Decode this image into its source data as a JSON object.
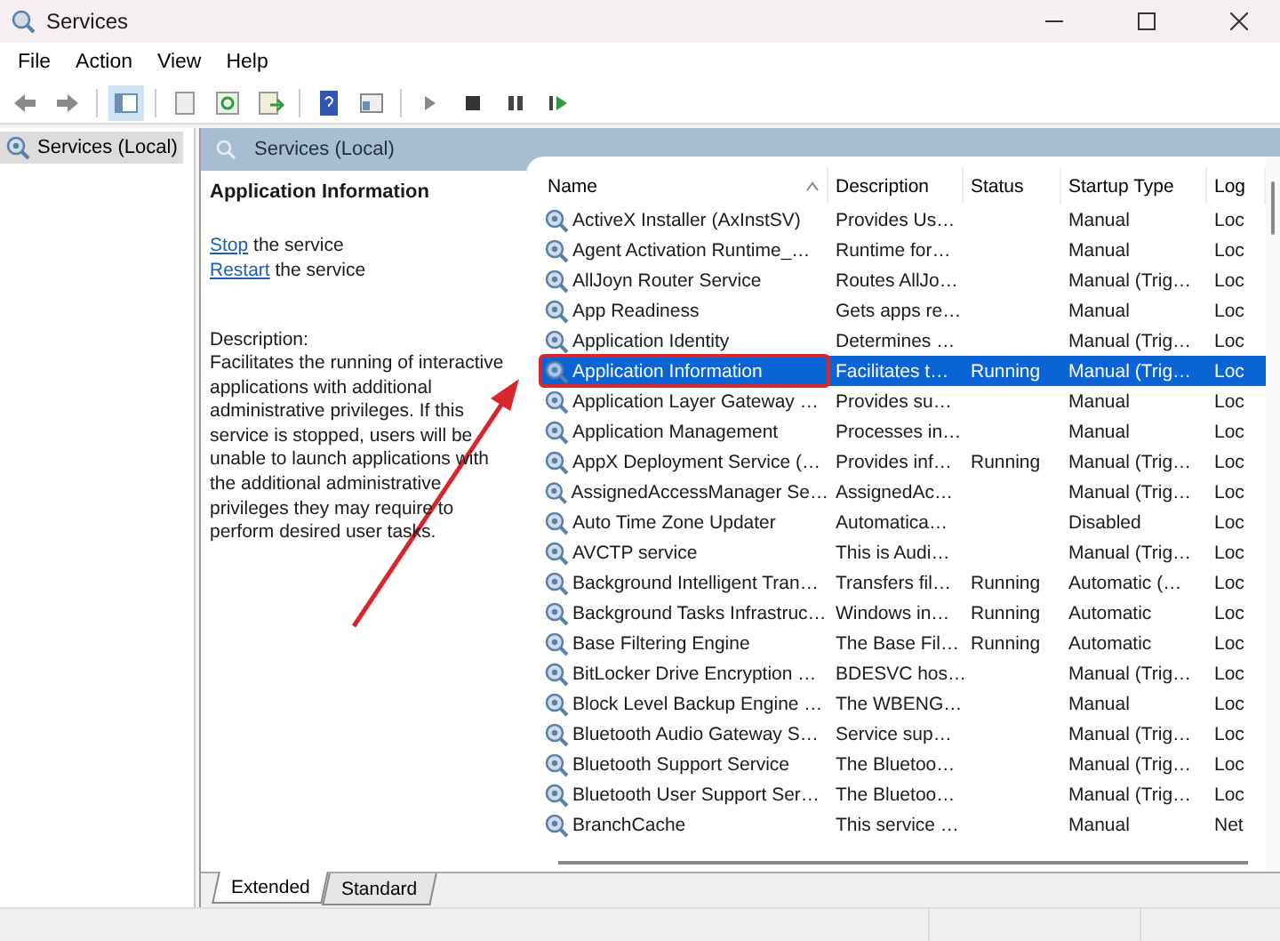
{
  "window": {
    "title": "Services"
  },
  "menu": [
    "File",
    "Action",
    "View",
    "Help"
  ],
  "tree": {
    "items": [
      {
        "label": "Services (Local)",
        "selected": true
      }
    ]
  },
  "panel": {
    "title": "Services (Local)"
  },
  "details": {
    "title": "Application Information",
    "actions": [
      {
        "link": "Stop",
        "rest": "the service"
      },
      {
        "link": "Restart",
        "rest": "the service"
      }
    ],
    "description_label": "Description:",
    "description": "Facilitates the running of interactive applications with additional administrative privileges.  If this service is stopped, users will be unable to launch applications with the additional administrative privileges they may require to perform desired user tasks."
  },
  "table": {
    "columns": [
      "Name",
      "Description",
      "Status",
      "Startup Type",
      "Log"
    ],
    "rows": [
      {
        "name": "ActiveX Installer (AxInstSV)",
        "description": "Provides Us…",
        "status": "",
        "startup": "Manual",
        "log": "Loc",
        "selected": false,
        "highlighted": false
      },
      {
        "name": "Agent Activation Runtime_…",
        "description": "Runtime for…",
        "status": "",
        "startup": "Manual",
        "log": "Loc",
        "selected": false,
        "highlighted": false
      },
      {
        "name": "AllJoyn Router Service",
        "description": "Routes AllJo…",
        "status": "",
        "startup": "Manual (Trig…",
        "log": "Loc",
        "selected": false,
        "highlighted": false
      },
      {
        "name": "App Readiness",
        "description": "Gets apps re…",
        "status": "",
        "startup": "Manual",
        "log": "Loc",
        "selected": false,
        "highlighted": false
      },
      {
        "name": "Application Identity",
        "description": "Determines …",
        "status": "",
        "startup": "Manual (Trig…",
        "log": "Loc",
        "selected": false,
        "highlighted": false
      },
      {
        "name": "Application Information",
        "description": "Facilitates t…",
        "status": "Running",
        "startup": "Manual (Trig…",
        "log": "Loc",
        "selected": true,
        "highlighted": true
      },
      {
        "name": "Application Layer Gateway …",
        "description": "Provides su…",
        "status": "",
        "startup": "Manual",
        "log": "Loc",
        "selected": false,
        "highlighted": false
      },
      {
        "name": "Application Management",
        "description": "Processes in…",
        "status": "",
        "startup": "Manual",
        "log": "Loc",
        "selected": false,
        "highlighted": false
      },
      {
        "name": "AppX Deployment Service (…",
        "description": "Provides inf…",
        "status": "Running",
        "startup": "Manual (Trig…",
        "log": "Loc",
        "selected": false,
        "highlighted": false
      },
      {
        "name": "AssignedAccessManager Se…",
        "description": "AssignedAc…",
        "status": "",
        "startup": "Manual (Trig…",
        "log": "Loc",
        "selected": false,
        "highlighted": false
      },
      {
        "name": "Auto Time Zone Updater",
        "description": "Automatica…",
        "status": "",
        "startup": "Disabled",
        "log": "Loc",
        "selected": false,
        "highlighted": false
      },
      {
        "name": "AVCTP service",
        "description": "This is Audi…",
        "status": "",
        "startup": "Manual (Trig…",
        "log": "Loc",
        "selected": false,
        "highlighted": false
      },
      {
        "name": "Background Intelligent Tran…",
        "description": "Transfers fil…",
        "status": "Running",
        "startup": "Automatic (…",
        "log": "Loc",
        "selected": false,
        "highlighted": false
      },
      {
        "name": "Background Tasks Infrastruc…",
        "description": "Windows in…",
        "status": "Running",
        "startup": "Automatic",
        "log": "Loc",
        "selected": false,
        "highlighted": false
      },
      {
        "name": "Base Filtering Engine",
        "description": "The Base Fil…",
        "status": "Running",
        "startup": "Automatic",
        "log": "Loc",
        "selected": false,
        "highlighted": false
      },
      {
        "name": "BitLocker Drive Encryption …",
        "description": "BDESVC hos…",
        "status": "",
        "startup": "Manual (Trig…",
        "log": "Loc",
        "selected": false,
        "highlighted": false
      },
      {
        "name": "Block Level Backup Engine …",
        "description": "The WBENG…",
        "status": "",
        "startup": "Manual",
        "log": "Loc",
        "selected": false,
        "highlighted": false
      },
      {
        "name": "Bluetooth Audio Gateway S…",
        "description": "Service sup…",
        "status": "",
        "startup": "Manual (Trig…",
        "log": "Loc",
        "selected": false,
        "highlighted": false
      },
      {
        "name": "Bluetooth Support Service",
        "description": "The Bluetoo…",
        "status": "",
        "startup": "Manual (Trig…",
        "log": "Loc",
        "selected": false,
        "highlighted": false
      },
      {
        "name": "Bluetooth User Support Ser…",
        "description": "The Bluetoo…",
        "status": "",
        "startup": "Manual (Trig…",
        "log": "Loc",
        "selected": false,
        "highlighted": false
      },
      {
        "name": "BranchCache",
        "description": "This service …",
        "status": "",
        "startup": "Manual",
        "log": "Net",
        "selected": false,
        "highlighted": false
      }
    ]
  },
  "view_tabs": [
    {
      "label": "Extended",
      "selected": true
    },
    {
      "label": "Standard",
      "selected": false
    }
  ],
  "annotation": {
    "arrow": true
  }
}
